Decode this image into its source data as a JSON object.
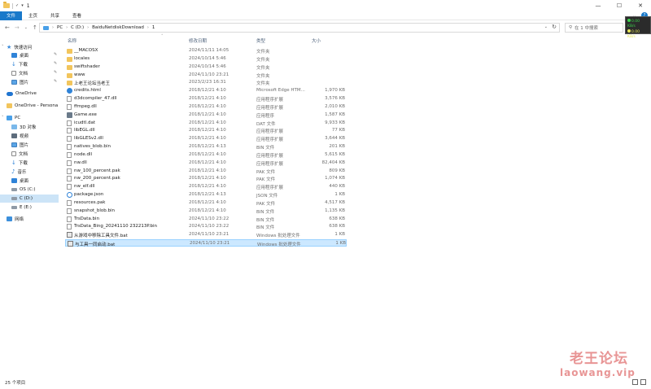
{
  "titlebar": {
    "title": "1",
    "controls": [
      "—",
      "☐",
      "✕"
    ]
  },
  "ribbon": {
    "tabs": [
      {
        "label": "文件",
        "active": true
      },
      {
        "label": "主页",
        "active": false
      },
      {
        "label": "共享",
        "active": false
      },
      {
        "label": "查看",
        "active": false
      }
    ]
  },
  "address": {
    "crumbs": [
      "PC",
      "C (D:)",
      "BaiduNetdiskDownload",
      "1"
    ],
    "search_placeholder": "在 1 中搜索"
  },
  "netwidget": {
    "up": "0.00 KB/s",
    "down": "0.00 KB/s"
  },
  "sidebar": {
    "quick_access": "快速访问",
    "quick_items": [
      {
        "label": "桌面",
        "icon": "desktop-icon"
      },
      {
        "label": "下载",
        "icon": "download-icon"
      },
      {
        "label": "文档",
        "icon": "document-icon"
      },
      {
        "label": "图片",
        "icon": "picture-icon"
      }
    ],
    "onedrive": "OneDrive",
    "onedrive_personal": "OneDrive - Persona",
    "pc": "PC",
    "pc_items": [
      {
        "label": "3D 对象",
        "icon": "3d-objects-icon"
      },
      {
        "label": "视频",
        "icon": "video-icon"
      },
      {
        "label": "图片",
        "icon": "picture-icon"
      },
      {
        "label": "文档",
        "icon": "document-icon"
      },
      {
        "label": "下载",
        "icon": "download-icon"
      },
      {
        "label": "音乐",
        "icon": "music-icon"
      },
      {
        "label": "桌面",
        "icon": "desktop-icon"
      },
      {
        "label": "OS (C:)",
        "icon": "drive-icon"
      },
      {
        "label": "C (D:)",
        "icon": "drive-icon"
      },
      {
        "label": "E (E:)",
        "icon": "drive-icon"
      }
    ],
    "network": "网络"
  },
  "columns": {
    "name": "名称",
    "date": "修改日期",
    "type": "类型",
    "size": "大小"
  },
  "files": [
    {
      "name": "__MACOSX",
      "date": "2024/11/11 14:05",
      "type": "文件夹",
      "size": "",
      "icon": "folder"
    },
    {
      "name": "locales",
      "date": "2024/10/14 5:46",
      "type": "文件夹",
      "size": "",
      "icon": "folder"
    },
    {
      "name": "swiftshader",
      "date": "2024/10/14 5:46",
      "type": "文件夹",
      "size": "",
      "icon": "folder"
    },
    {
      "name": "www",
      "date": "2024/11/10 23:21",
      "type": "文件夹",
      "size": "",
      "icon": "folder"
    },
    {
      "name": "上老王论坛当老王",
      "date": "2023/2/23 16:31",
      "type": "文件夹",
      "size": "",
      "icon": "folder"
    },
    {
      "name": "credits.html",
      "date": "2018/12/21 4:10",
      "type": "Microsoft Edge HTM...",
      "size": "1,970 KB",
      "icon": "html"
    },
    {
      "name": "d3dcompiler_47.dll",
      "date": "2018/12/21 4:10",
      "type": "应用程序扩展",
      "size": "3,576 KB",
      "icon": "file"
    },
    {
      "name": "ffmpeg.dll",
      "date": "2018/12/21 4:10",
      "type": "应用程序扩展",
      "size": "2,010 KB",
      "icon": "file"
    },
    {
      "name": "Game.exe",
      "date": "2018/12/21 4:10",
      "type": "应用程序",
      "size": "1,587 KB",
      "icon": "exe"
    },
    {
      "name": "icudtl.dat",
      "date": "2018/12/21 4:10",
      "type": "DAT 文件",
      "size": "9,933 KB",
      "icon": "file"
    },
    {
      "name": "libEGL.dll",
      "date": "2018/12/21 4:10",
      "type": "应用程序扩展",
      "size": "77 KB",
      "icon": "file"
    },
    {
      "name": "libGLESv2.dll",
      "date": "2018/12/21 4:10",
      "type": "应用程序扩展",
      "size": "3,644 KB",
      "icon": "file"
    },
    {
      "name": "natives_blob.bin",
      "date": "2018/12/21 4:13",
      "type": "BIN 文件",
      "size": "201 KB",
      "icon": "file"
    },
    {
      "name": "node.dll",
      "date": "2018/12/21 4:10",
      "type": "应用程序扩展",
      "size": "5,615 KB",
      "icon": "file"
    },
    {
      "name": "nw.dll",
      "date": "2018/12/21 4:10",
      "type": "应用程序扩展",
      "size": "82,404 KB",
      "icon": "file"
    },
    {
      "name": "nw_100_percent.pak",
      "date": "2018/12/21 4:10",
      "type": "PAK 文件",
      "size": "809 KB",
      "icon": "file"
    },
    {
      "name": "nw_200_percent.pak",
      "date": "2018/12/21 4:10",
      "type": "PAK 文件",
      "size": "1,074 KB",
      "icon": "file"
    },
    {
      "name": "nw_elf.dll",
      "date": "2018/12/21 4:10",
      "type": "应用程序扩展",
      "size": "440 KB",
      "icon": "file"
    },
    {
      "name": "package.json",
      "date": "2018/12/21 4:13",
      "type": "JSON 文件",
      "size": "1 KB",
      "icon": "json"
    },
    {
      "name": "resources.pak",
      "date": "2018/12/21 4:10",
      "type": "PAK 文件",
      "size": "4,517 KB",
      "icon": "file"
    },
    {
      "name": "snapshot_blob.bin",
      "date": "2018/12/21 4:10",
      "type": "BIN 文件",
      "size": "1,135 KB",
      "icon": "file"
    },
    {
      "name": "TrsData.bin",
      "date": "2024/11/10 23:22",
      "type": "BIN 文件",
      "size": "638 KB",
      "icon": "file"
    },
    {
      "name": "TrsData_Bing_20241110 232213P.bin",
      "date": "2024/11/10 23:22",
      "type": "BIN 文件",
      "size": "638 KB",
      "icon": "file"
    },
    {
      "name": "从游戏中移除工具文件.bat",
      "date": "2024/11/10 23:21",
      "type": "Windows 批处理文件",
      "size": "1 KB",
      "icon": "bat"
    },
    {
      "name": "与工具一同启动.bat",
      "date": "2024/11/10 23:21",
      "type": "Windows 批处理文件",
      "size": "1 KB",
      "icon": "bat",
      "selected": true
    }
  ],
  "status": {
    "count": "25 个项目"
  },
  "watermark": {
    "line1": "老王论坛",
    "line2": "laowang.vip"
  }
}
